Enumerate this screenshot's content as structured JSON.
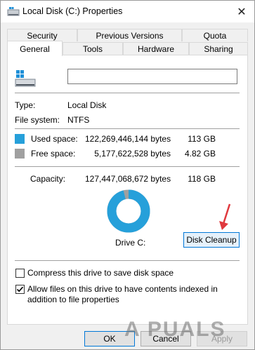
{
  "window": {
    "title": "Local Disk (C:) Properties",
    "close_symbol": "✕"
  },
  "tabs_row1": [
    {
      "label": "Security"
    },
    {
      "label": "Previous Versions"
    },
    {
      "label": "Quota"
    }
  ],
  "tabs_row2": [
    {
      "label": "General",
      "active": true
    },
    {
      "label": "Tools"
    },
    {
      "label": "Hardware"
    },
    {
      "label": "Sharing"
    }
  ],
  "general": {
    "name_value": "",
    "type_label": "Type:",
    "type_value": "Local Disk",
    "fs_label": "File system:",
    "fs_value": "NTFS",
    "used": {
      "label": "Used space:",
      "bytes": "122,269,446,144 bytes",
      "size": "113 GB",
      "color": "#26a0da"
    },
    "free": {
      "label": "Free space:",
      "bytes": "5,177,622,528 bytes",
      "size": "4.82 GB",
      "color": "#a0a0a0"
    },
    "capacity": {
      "label": "Capacity:",
      "bytes": "127,447,068,672 bytes",
      "size": "118 GB"
    },
    "used_fraction": 0.9594,
    "drive_label": "Drive C:",
    "cleanup_button": "Disk Cleanup",
    "compress_label": "Compress this drive to save disk space",
    "compress_checked": false,
    "index_label": "Allow files on this drive to have contents indexed in addition to file properties",
    "index_checked": true
  },
  "buttons": {
    "ok": "OK",
    "cancel": "Cancel",
    "apply": "Apply"
  },
  "watermark": "A PUALS",
  "colors": {
    "arrow": "#e0393e"
  }
}
